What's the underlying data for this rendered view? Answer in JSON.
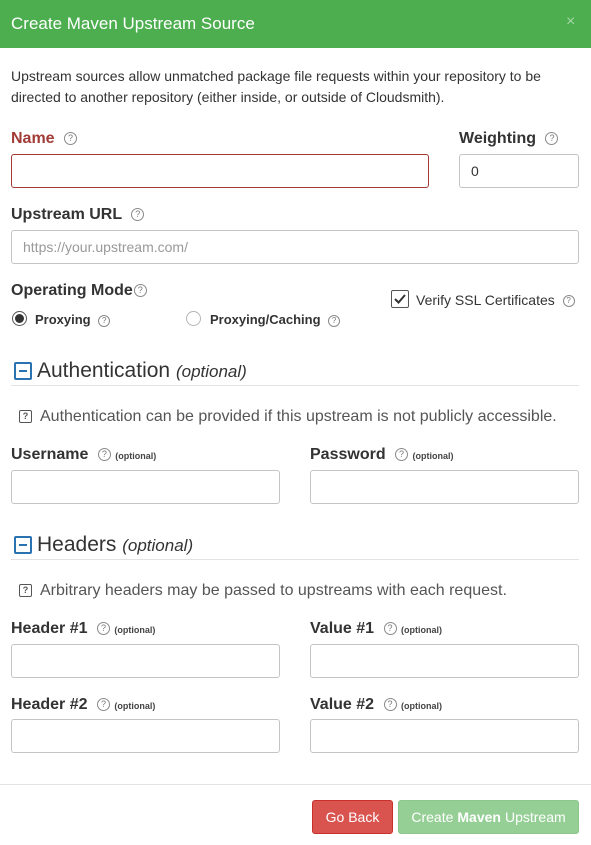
{
  "dialog": {
    "title": "Create Maven Upstream Source",
    "close_glyph": "×",
    "intro": "Upstream sources allow unmatched package file requests within your repository to be directed to another repository (either inside, or outside of Cloudsmith)."
  },
  "help_glyph": "?",
  "optional_tag": "(optional)",
  "fields": {
    "name": {
      "label": "Name",
      "value": ""
    },
    "weighting": {
      "label": "Weighting",
      "value": "0"
    },
    "upstream_url": {
      "label": "Upstream URL",
      "placeholder": "https://your.upstream.com/"
    }
  },
  "operating_mode": {
    "label": "Operating Mode",
    "options": [
      {
        "label": "Proxying",
        "selected": true
      },
      {
        "label": "Proxying/Caching",
        "selected": false
      }
    ]
  },
  "verify_ssl": {
    "label": "Verify SSL Certificates",
    "checked": true
  },
  "authentication": {
    "title": "Authentication",
    "title_optional": "(optional)",
    "info": "Authentication can be provided if this upstream is not publicly accessible.",
    "username_label": "Username",
    "password_label": "Password"
  },
  "headers": {
    "title": "Headers",
    "title_optional": "(optional)",
    "info": "Arbitrary headers may be passed to upstreams with each request.",
    "header1_label": "Header #1",
    "value1_label": "Value #1",
    "header2_label": "Header #2",
    "value2_label": "Value #2"
  },
  "footer": {
    "back_label": "Go Back",
    "create_prefix": "Create",
    "create_bold": "Maven",
    "create_suffix": "Upstream"
  },
  "colors": {
    "header_bg": "#4cae4f",
    "error_red": "#a23b36",
    "back_button": "#d9534f",
    "create_button_disabled": "#96cf96",
    "collapse_blue": "#2b73b0"
  }
}
